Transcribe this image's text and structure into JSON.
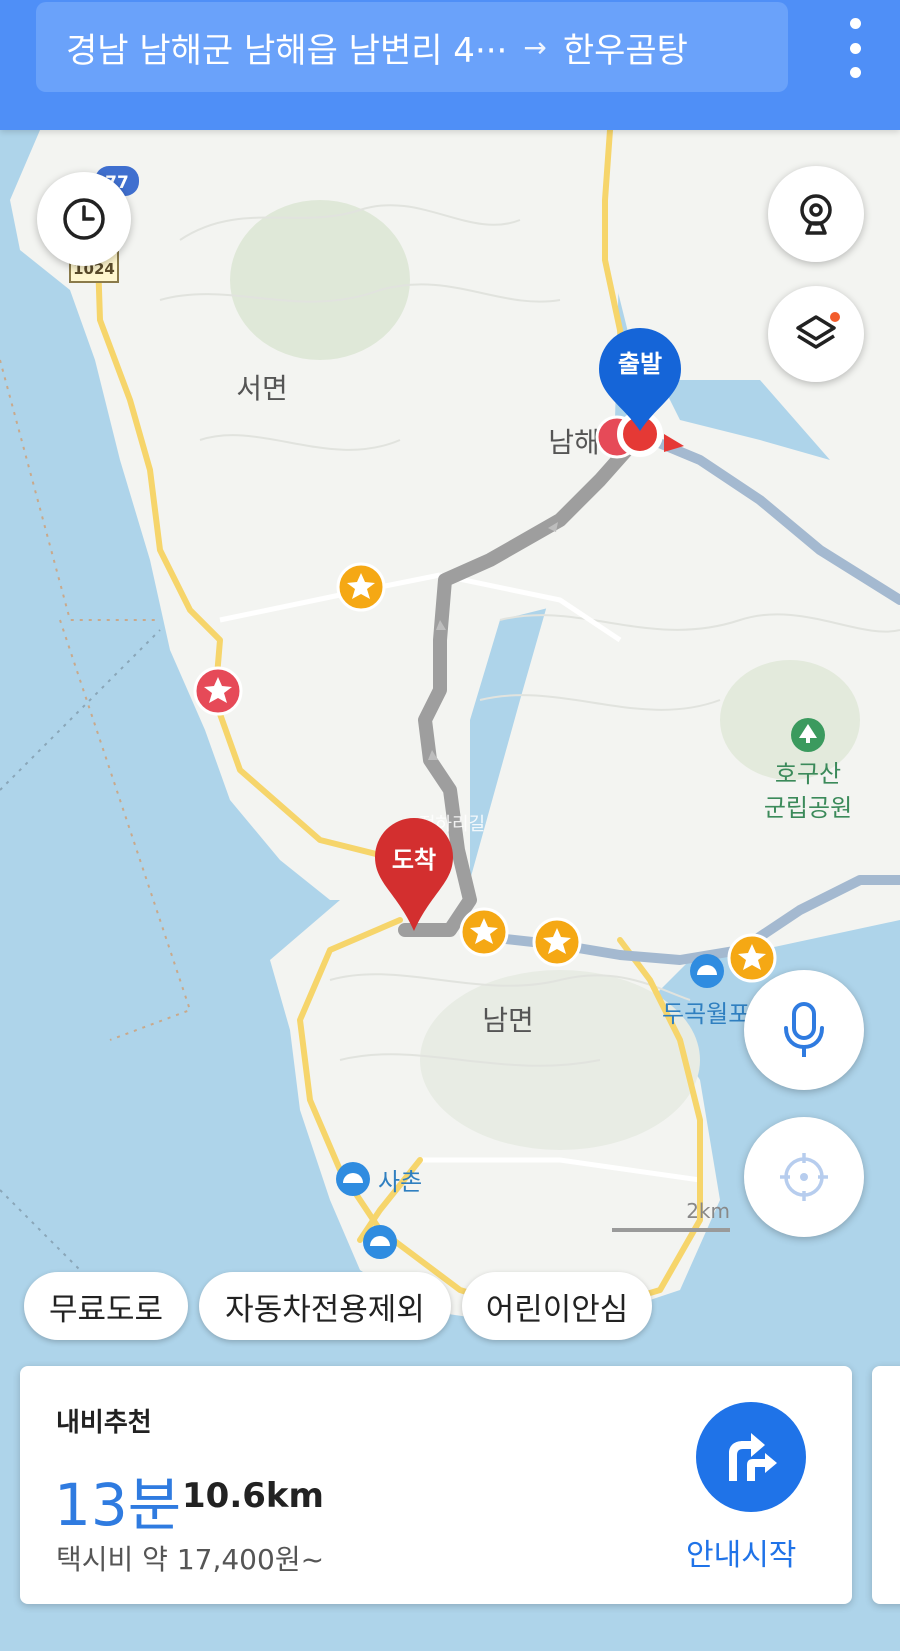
{
  "header": {
    "origin": "경남 남해군 남해읍 남변리 4···",
    "arrow": "→",
    "destination": "한우곰탕",
    "menu_icon": "more-vertical-icon"
  },
  "map": {
    "labels": {
      "seomyeon": "서면",
      "namhae": "남해",
      "namhae_partial": "남해",
      "hogusan_line1": "호구산",
      "hogusan_line2": "군립공원",
      "nammyeon": "남면",
      "dugok": "두곡월포",
      "sachon": "사촌",
      "road_faint": "전하리길"
    },
    "route_shields": [
      "77",
      "1024"
    ],
    "markers": {
      "start": "출발",
      "end": "도착"
    },
    "scale": "2km",
    "colors": {
      "sea": "#aed4ea",
      "land": "#f3f4f1",
      "route": "#9e9e9e",
      "start_marker": "#1565d8",
      "end_marker": "#d32f2f",
      "star_poi": "#f5a814",
      "red_poi": "#e64a58"
    }
  },
  "controls": {
    "history_icon": "clock-icon",
    "cctv_icon": "cctv-icon",
    "layers_icon": "layers-icon",
    "voice_icon": "microphone-icon",
    "location_icon": "crosshair-icon"
  },
  "options": [
    "무료도로",
    "자동차전용제외",
    "어린이안심"
  ],
  "route_card": {
    "title": "내비추천",
    "time": "13분",
    "distance": "10.6km",
    "fare": "택시비 약 17,400원~",
    "start_label": "안내시작"
  }
}
